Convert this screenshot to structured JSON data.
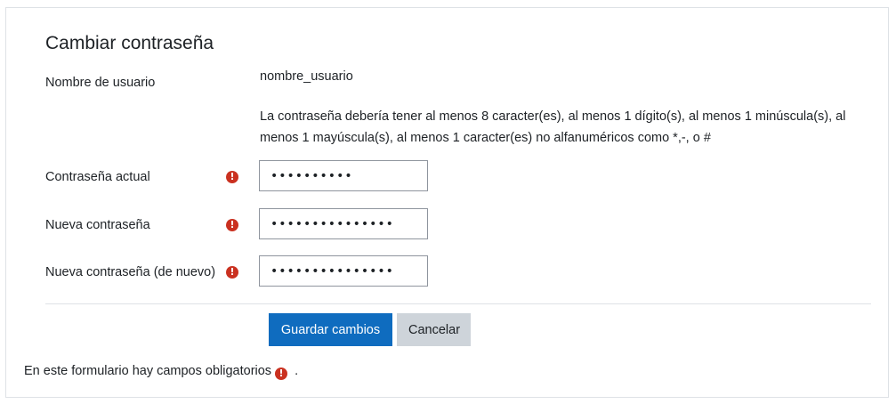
{
  "form": {
    "title": "Cambiar contraseña",
    "username": {
      "label": "Nombre de usuario",
      "value": "nombre_usuario"
    },
    "password_policy": "La contraseña debería tener al menos 8 caracter(es), al menos 1 dígito(s), al menos 1 minúscula(s), al menos 1 mayúscula(s), al menos 1 caracter(es) no alfanuméricos como *,-, o #",
    "current_password": {
      "label": "Contraseña actual",
      "value": "••••••••••",
      "required_icon": "exclamation-circle-icon"
    },
    "new_password": {
      "label": "Nueva contraseña",
      "value": "•••••••••••••••",
      "required_icon": "exclamation-circle-icon"
    },
    "new_password_again": {
      "label": "Nueva contraseña (de nuevo)",
      "value": "•••••••••••••••",
      "required_icon": "exclamation-circle-icon"
    },
    "buttons": {
      "save": "Guardar cambios",
      "cancel": "Cancelar"
    },
    "required_note": {
      "before": "En este formulario hay campos obligatorios",
      "after": "."
    }
  },
  "colors": {
    "primary": "#0f6cbf",
    "secondary": "#ced4da",
    "required": "#ca3120",
    "border": "#dee2e6"
  }
}
